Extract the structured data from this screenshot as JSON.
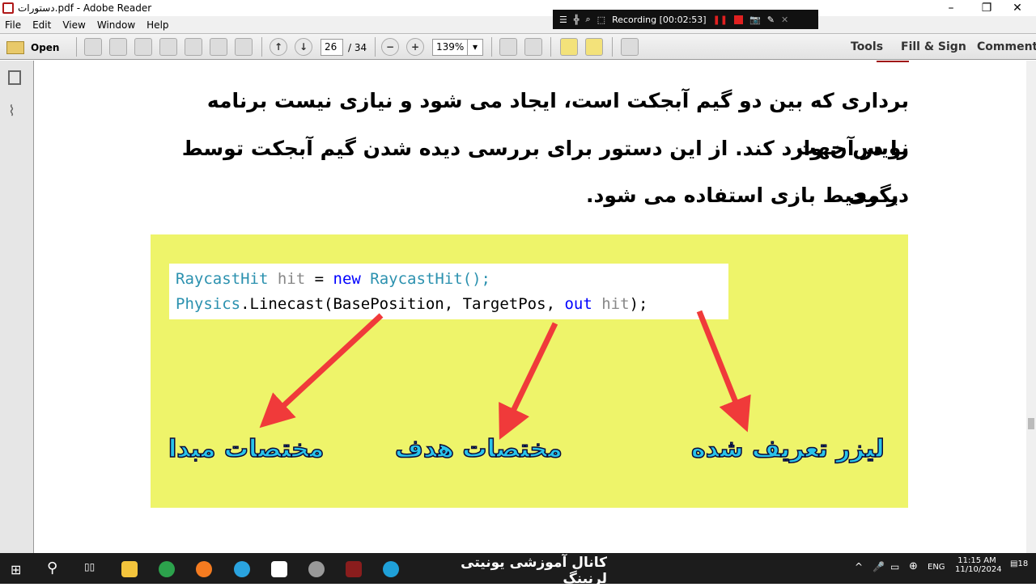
{
  "window": {
    "title": "دستورات.pdf - Adobe Reader",
    "minimize": "–",
    "restore": "❐",
    "close": "✕"
  },
  "menu": [
    "File",
    "Edit",
    "View",
    "Window",
    "Help"
  ],
  "toolbar": {
    "open_label": "Open",
    "page_current": "26",
    "page_total": "/ 34",
    "zoom": "139%",
    "tools": "Tools",
    "fill_sign": "Fill & Sign",
    "comment": "Comment"
  },
  "recorder": {
    "status": "Recording [00:02:53]"
  },
  "document": {
    "lines": [
      "برداری که بین دو گیم آبجکت است، ایجاد می شود و نیازی نیست برنامه نویس جهت",
      "را در آن وارد کند. از این دستور برای بررسی دیده شدن گیم آبجکت توسط دیگری",
      "در محیط بازی استفاده می شود."
    ],
    "code": {
      "line1": {
        "type": "RaycastHit",
        "var": "hit",
        "eq": " = ",
        "kw": "new",
        "ctor": " RaycastHit();"
      },
      "line2": {
        "cls": "Physics",
        "method": ".Linecast(BasePosition, TargetPos, ",
        "kw": "out",
        "var": "hit",
        "end": ");"
      }
    },
    "labels": {
      "origin": "مختصات مبدا",
      "target": "مختصات هدف",
      "laser": "لیزر تعریف شده"
    }
  },
  "taskbar": {
    "overlay": "کانال آموزشی یونیتی لرنینگ",
    "lang": "ENG",
    "time": "11:15 AM",
    "date": "11/10/2024",
    "notifications": "18"
  }
}
